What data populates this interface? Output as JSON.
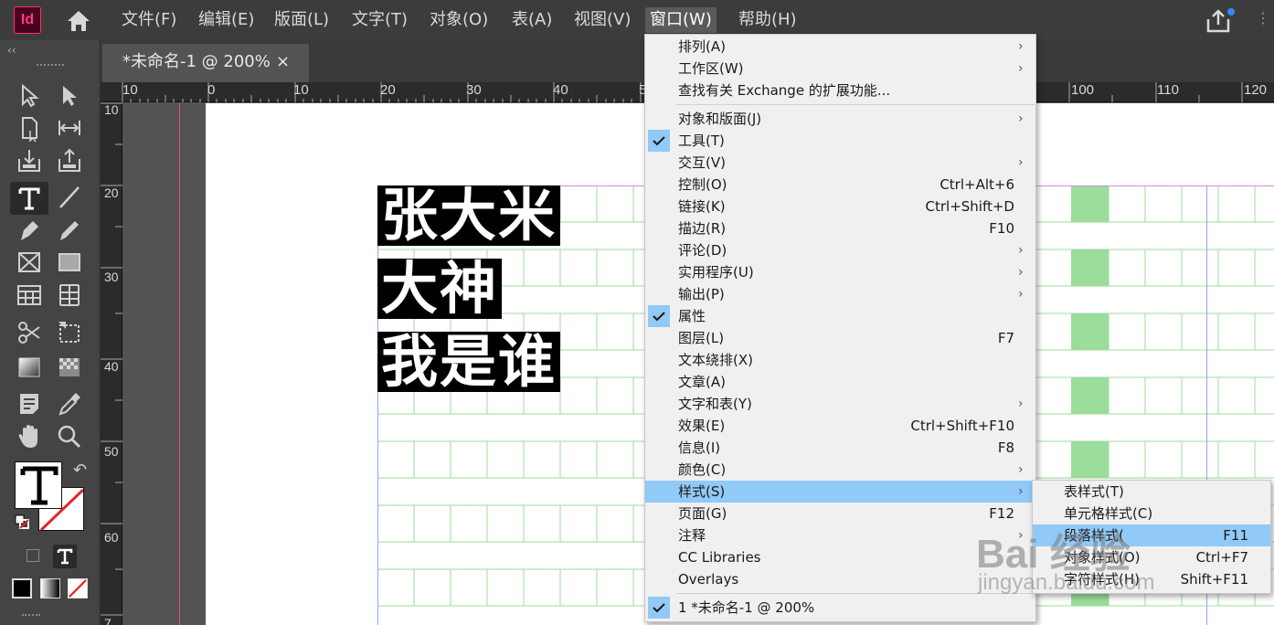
{
  "app": {
    "logo": "Id"
  },
  "menubar": [
    {
      "label": "文件(F)"
    },
    {
      "label": "编辑(E)"
    },
    {
      "label": "版面(L)"
    },
    {
      "label": "文字(T)"
    },
    {
      "label": "对象(O)"
    },
    {
      "label": "表(A)"
    },
    {
      "label": "视图(V)"
    },
    {
      "label": "窗口(W)"
    },
    {
      "label": "帮助(H)"
    }
  ],
  "active_menu": "窗口(W)",
  "tab": {
    "title": "*未命名-1 @ 200%",
    "close": "×"
  },
  "ruler_top": [
    "10",
    "0",
    "10",
    "20",
    "30",
    "40",
    "5",
    "100",
    "110",
    "120"
  ],
  "ruler_left": [
    "10",
    "20",
    "30",
    "40",
    "50",
    "60",
    "7"
  ],
  "document": {
    "lines": [
      "张大米",
      "大神",
      "我是谁"
    ]
  },
  "window_menu": [
    {
      "label": "排列(A)",
      "submenu": true
    },
    {
      "label": "工作区(W)",
      "submenu": true
    },
    {
      "label": "查找有关 Exchange 的扩展功能...",
      "separator_after": true
    },
    {
      "label": "对象和版面(J)",
      "submenu": true
    },
    {
      "label": "工具(T)",
      "checked": true
    },
    {
      "label": "交互(V)",
      "submenu": true
    },
    {
      "label": "控制(O)",
      "shortcut": "Ctrl+Alt+6"
    },
    {
      "label": "链接(K)",
      "shortcut": "Ctrl+Shift+D"
    },
    {
      "label": "描边(R)",
      "shortcut": "F10"
    },
    {
      "label": "评论(D)",
      "submenu": true
    },
    {
      "label": "实用程序(U)",
      "submenu": true
    },
    {
      "label": "输出(P)",
      "submenu": true
    },
    {
      "label": "属性",
      "checked": true
    },
    {
      "label": "图层(L)",
      "shortcut": "F7"
    },
    {
      "label": "文本绕排(X)"
    },
    {
      "label": "文章(A)"
    },
    {
      "label": "文字和表(Y)",
      "submenu": true
    },
    {
      "label": "效果(E)",
      "shortcut": "Ctrl+Shift+F10"
    },
    {
      "label": "信息(I)",
      "shortcut": "F8"
    },
    {
      "label": "颜色(C)",
      "submenu": true
    },
    {
      "label": "样式(S)",
      "submenu": true,
      "highlighted": true
    },
    {
      "label": "页面(G)",
      "shortcut": "F12"
    },
    {
      "label": "注释",
      "submenu": true
    },
    {
      "label": "CC Libraries"
    },
    {
      "label": "Overlays",
      "separator_after": true
    },
    {
      "label": "1 *未命名-1 @ 200%",
      "checked": true
    }
  ],
  "styles_submenu": [
    {
      "label": "表样式(T)"
    },
    {
      "label": "单元格样式(C)"
    },
    {
      "label": "段落样式(",
      "shortcut": "F11",
      "highlighted": true
    },
    {
      "label": "对象样式(O)",
      "shortcut": "Ctrl+F7"
    },
    {
      "label": "字符样式(H)",
      "shortcut": "Shift+F11"
    }
  ],
  "watermark": {
    "brand": "Bai 经验",
    "url": "jingyan.baidu.com"
  },
  "colors": {
    "menubar": "#3c3c3c",
    "highlight": "#91c9f7",
    "grid": "#9bdd9b",
    "logo": "#ff3366"
  }
}
